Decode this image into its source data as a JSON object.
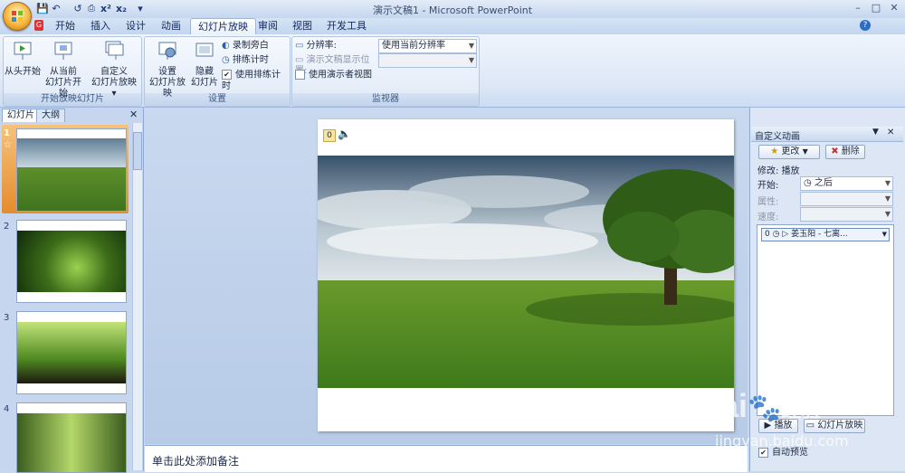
{
  "window": {
    "title": "演示文稿1 - Microsoft PowerPoint",
    "controls": {
      "minimize": "–",
      "maximize": "□",
      "close": "✕"
    }
  },
  "qat": {
    "save": "💾",
    "undo": "↶",
    "redo": "↺",
    "more": "▾"
  },
  "tabs": [
    "开始",
    "插入",
    "设计",
    "动画",
    "幻灯片放映",
    "审阅",
    "视图",
    "开发工具"
  ],
  "active_tab": "幻灯片放映",
  "help": "?",
  "ribbon": {
    "start_group": {
      "label": "开始放映幻灯片",
      "from_beginning": "从头开始",
      "from_current_1": "从当前",
      "from_current_2": "幻灯片开始",
      "custom_1": "自定义",
      "custom_2": "幻灯片放映 ▾"
    },
    "setup_group": {
      "label": "设置",
      "setup_1": "设置",
      "setup_2": "幻灯片放映",
      "hide_1": "隐藏",
      "hide_2": "幻灯片",
      "record_narration": "录制旁白",
      "rehearse_timings": "排练计时",
      "use_rehearsed_timings": "使用排练计时",
      "use_rehearsed_checked": "✔"
    },
    "monitor_group": {
      "label": "监视器",
      "resolution_label": "分辨率:",
      "resolution_value": "使用当前分辨率",
      "show_on_label": "演示文稿显示位置:",
      "show_on_value": "",
      "presenter_view": "使用演示者视图"
    }
  },
  "slide_panel": {
    "tabs": [
      "幻灯片",
      "大纲"
    ],
    "close": "✕",
    "slides": [
      {
        "number": "1",
        "selected": true,
        "star": "☆"
      },
      {
        "number": "2",
        "selected": false
      },
      {
        "number": "3",
        "selected": false
      },
      {
        "number": "4",
        "selected": false
      }
    ]
  },
  "slide": {
    "anim_marker": "0",
    "sound_icon": "🔈"
  },
  "notes": {
    "placeholder": "单击此处添加备注"
  },
  "task_pane": {
    "title": "自定义动画",
    "change_button": "更改",
    "remove_button": "删除",
    "modify_label": "修改: 播放",
    "start_label": "开始:",
    "start_value": "之后",
    "property_label": "属性:",
    "speed_label": "速度:",
    "list_item_index": "0",
    "list_item_text": "姜玉阳 - 七离...",
    "play_button": "播放",
    "slideshow_button": "幻灯片放映",
    "autopreview_label": "自动预览",
    "autopreview_checked": "✔"
  },
  "watermark": {
    "brand": "Bai",
    "brand2": "经验",
    "url": "jingyan.baidu.com"
  },
  "colors": {
    "ribbon_bg": "#dde8f7",
    "accent": "#f3a34a",
    "panel_bg": "#c6d6ee"
  }
}
